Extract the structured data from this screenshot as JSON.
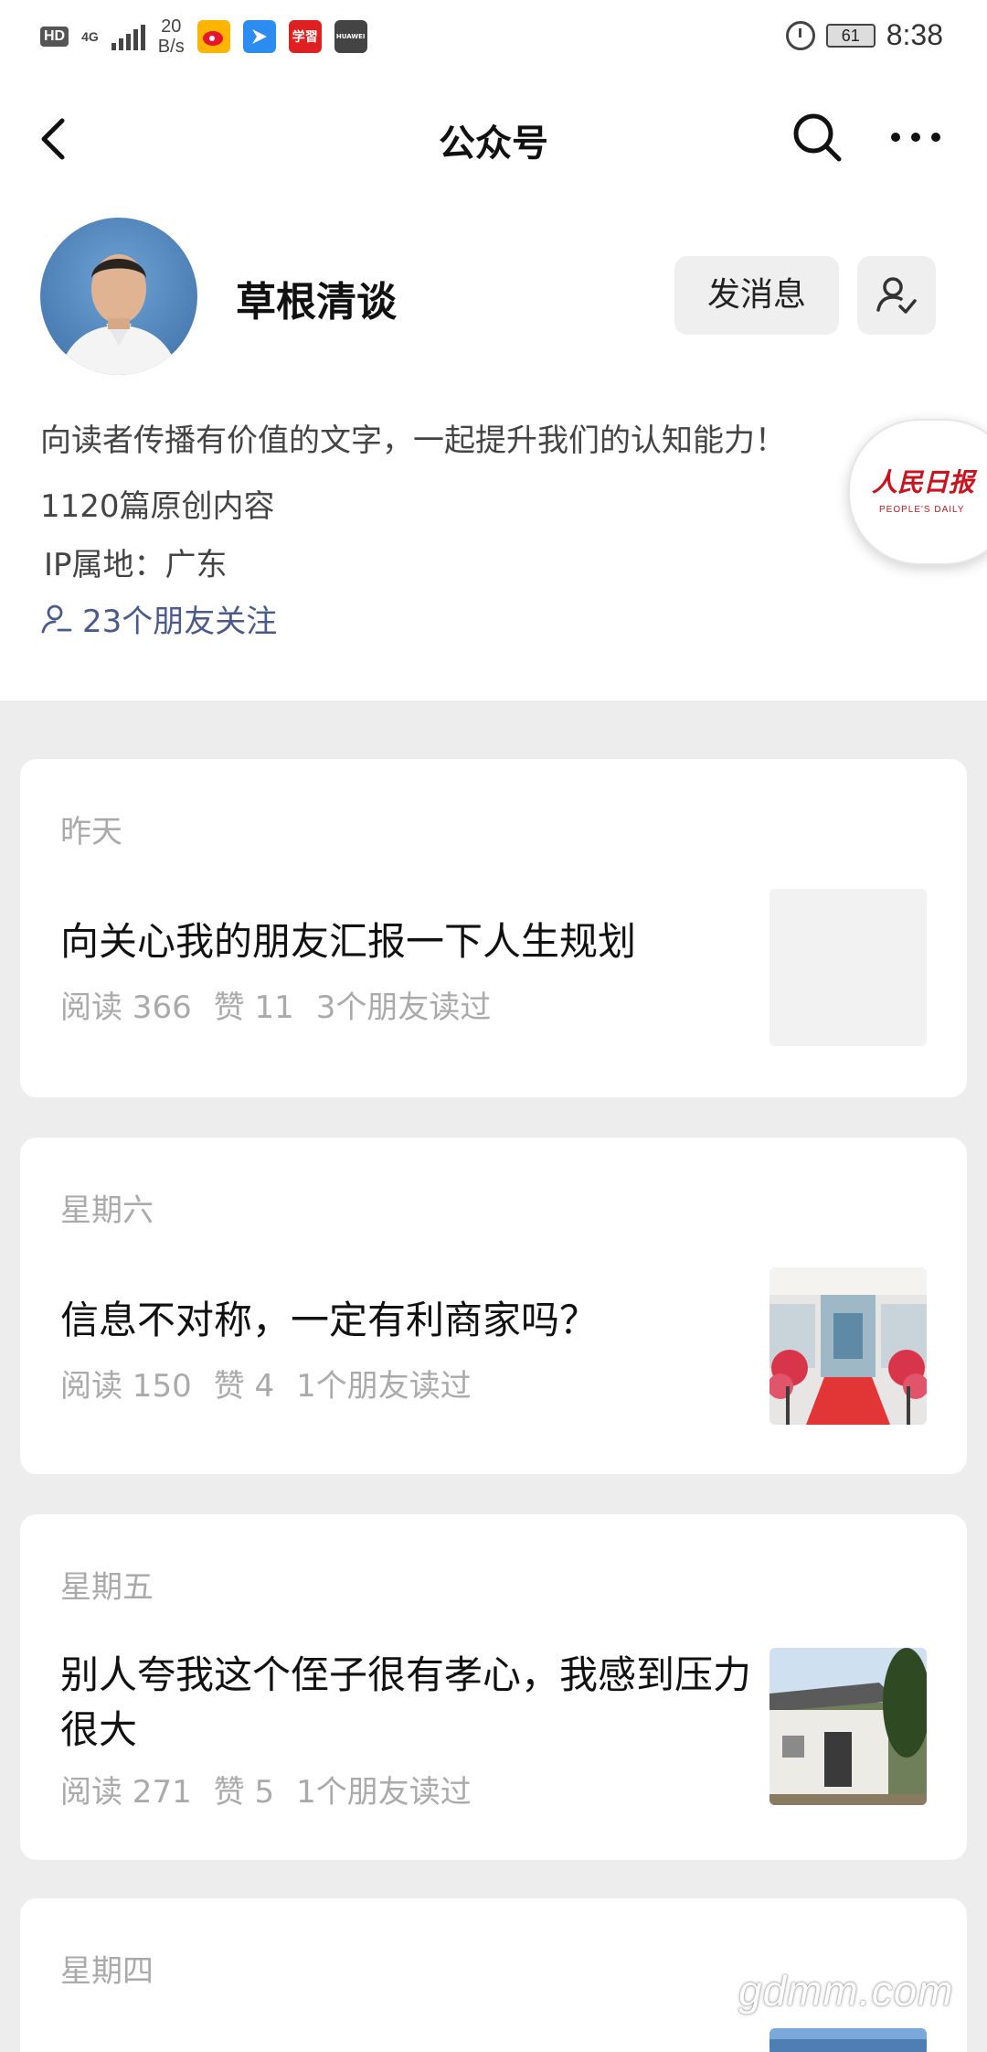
{
  "status_bar": {
    "hd": "HD",
    "network": "4G",
    "speed_value": "20",
    "speed_unit": "B/s",
    "battery": "61",
    "time": "8:38",
    "apps": [
      {
        "icon": "weibo-icon",
        "label": "",
        "color": "#ffb400"
      },
      {
        "icon": "blue-app-icon",
        "label": "",
        "color": "#2d8cf0"
      },
      {
        "icon": "xuexi-icon",
        "label": "学習",
        "color": "#e02020"
      },
      {
        "icon": "huawei-icon",
        "label": "HUAWEI",
        "color": "#444444"
      }
    ]
  },
  "nav": {
    "title": "公众号"
  },
  "profile": {
    "name": "草根清谈",
    "message_button": "发消息",
    "description": "向读者传播有价值的文字，一起提升我们的认知能力！",
    "original_count": "1120篇原创内容",
    "ip_location": "IP属地：广东",
    "friends_following": "23个朋友关注"
  },
  "floating_badge": {
    "brand": "人民日报",
    "subtitle": "PEOPLE'S DAILY"
  },
  "articles": [
    {
      "date": "昨天",
      "title": "向关心我的朋友汇报一下人生规划",
      "reads": "阅读 366",
      "likes": "赞 11",
      "friends_read": "3个朋友读过"
    },
    {
      "date": "星期六",
      "title": "信息不对称，一定有利商家吗？",
      "reads": "阅读 150",
      "likes": "赞 4",
      "friends_read": "1个朋友读过"
    },
    {
      "date": "星期五",
      "title": "别人夸我这个侄子很有孝心，我感到压力很大",
      "reads": "阅读 271",
      "likes": "赞 5",
      "friends_read": "1个朋友读过"
    },
    {
      "date": "星期四"
    }
  ],
  "watermark": "gdmm.com",
  "colors": {
    "page_bg": "#ededed",
    "card_bg": "#ffffff",
    "friend_link": "#4a5a8a",
    "muted_text": "#aaaaaa"
  }
}
